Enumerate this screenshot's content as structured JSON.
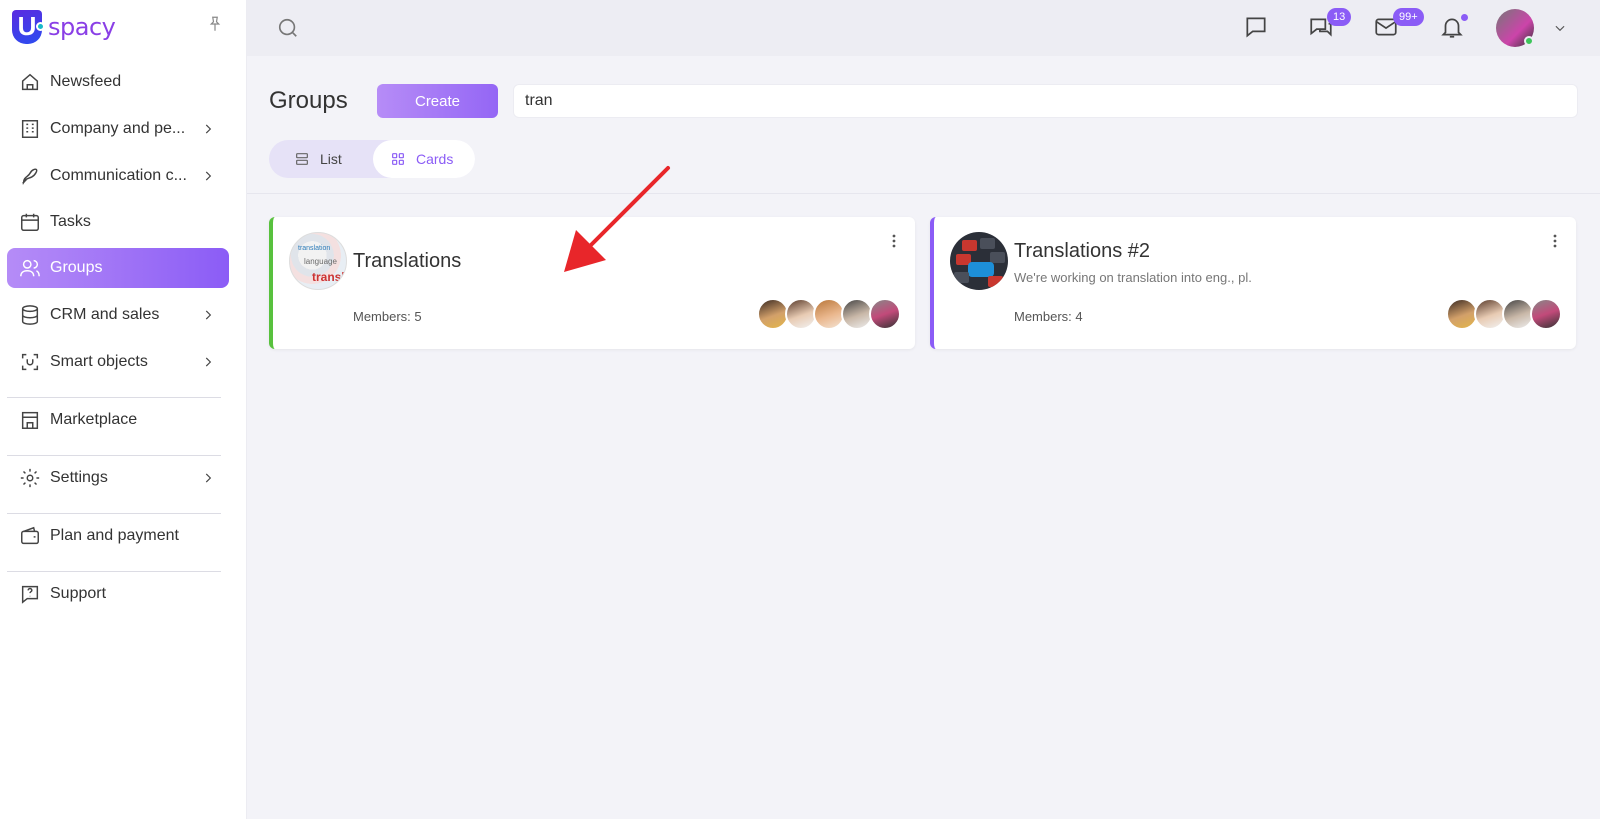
{
  "app": {
    "brand_letter": "U",
    "brand_text": "spacy"
  },
  "sidebar": {
    "items": [
      {
        "label": "Newsfeed"
      },
      {
        "label": "Company and pe..."
      },
      {
        "label": "Communication c..."
      },
      {
        "label": "Tasks"
      },
      {
        "label": "Groups"
      },
      {
        "label": "CRM and sales"
      },
      {
        "label": "Smart objects"
      },
      {
        "label": "Marketplace"
      },
      {
        "label": "Settings"
      },
      {
        "label": "Plan and payment"
      },
      {
        "label": "Support"
      }
    ],
    "active_item": "Groups"
  },
  "topbar": {
    "chat_badge": "13",
    "mail_badge": "99+"
  },
  "page": {
    "title": "Groups",
    "create_label": "Create",
    "search_value": "tran",
    "view_list_label": "List",
    "view_cards_label": "Cards",
    "active_view": "Cards"
  },
  "groups": [
    {
      "name": "Translations",
      "description": "",
      "members_label": "Members: 5",
      "accent": "#58c13e",
      "avatar_word": "translat",
      "member_count": 5
    },
    {
      "name": "Translations #2",
      "description": "We're working on translation into eng., pl.",
      "members_label": "Members: 4",
      "accent": "#8b5cf6",
      "member_count": 4
    }
  ],
  "colors": {
    "accent": "#8b5cf6",
    "badge": "#8b5cf6",
    "online": "#3cc55a",
    "annotation_arrow": "#e8262a"
  }
}
